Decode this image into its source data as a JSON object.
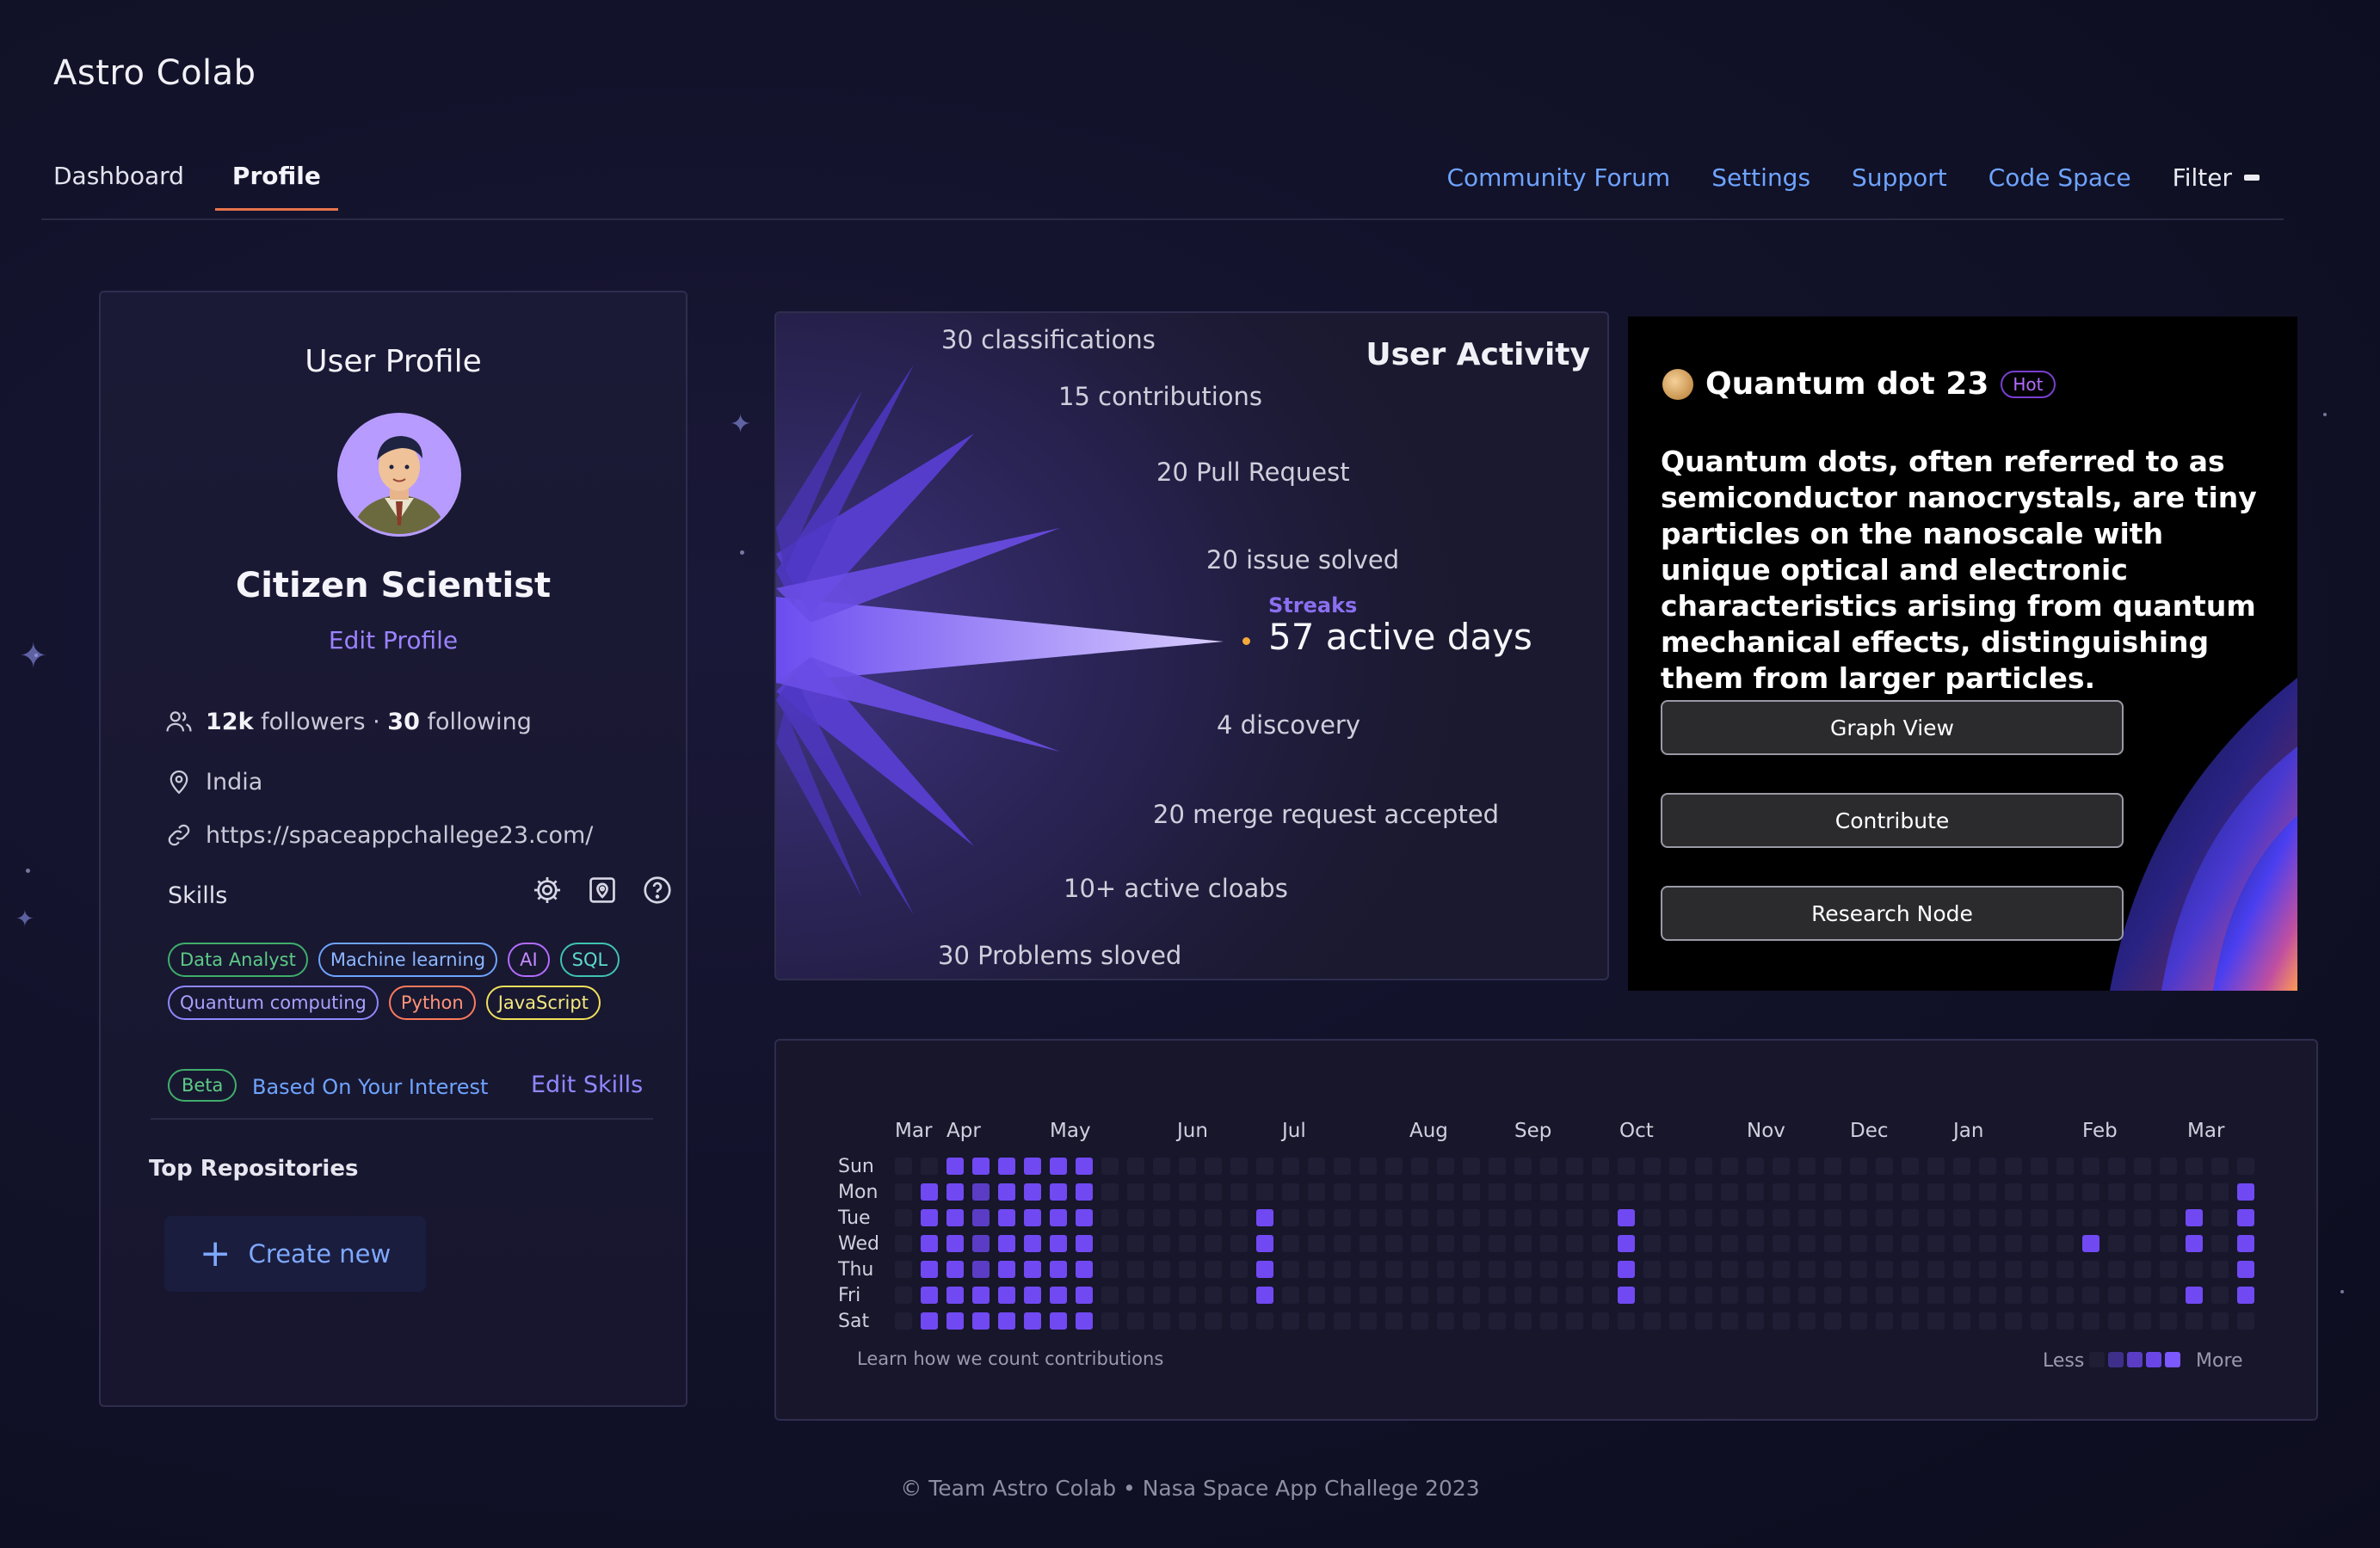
{
  "app": {
    "title": "Astro Colab"
  },
  "tabs": [
    {
      "label": "Dashboard"
    },
    {
      "label": "Profile"
    }
  ],
  "nav": {
    "links": [
      "Community Forum",
      "Settings",
      "Support",
      "Code Space"
    ],
    "filter_label": "Filter"
  },
  "profile": {
    "title": "User Profile",
    "name": "Citizen Scientist",
    "edit_label": "Edit Profile",
    "followers": "12k",
    "followers_label": "followers",
    "following": "30",
    "following_label": "following",
    "location": "India",
    "website": "https://spaceappchallege23.com/",
    "skills_label": "Skills",
    "skills": [
      {
        "label": "Data Analyst",
        "color": "#3fae6a"
      },
      {
        "label": "Machine learning",
        "color": "#6ea4ff"
      },
      {
        "label": "AI",
        "color": "#b36cff"
      },
      {
        "label": "SQL",
        "color": "#3ec3b2"
      },
      {
        "label": "Quantum computing",
        "color": "#8f88ff"
      },
      {
        "label": "Python",
        "color": "#ff7a5c"
      },
      {
        "label": "JavaScript",
        "color": "#f1e05a"
      }
    ],
    "beta_label": "Beta",
    "beta_text": "Based On Your Interest",
    "edit_skills_label": "Edit Skills",
    "top_repos_label": "Top Repositories",
    "create_new_label": "Create new"
  },
  "activity": {
    "title": "User Activity",
    "items": [
      "30 classifications",
      "15 contributions",
      "20 Pull Request",
      "20 issue solved",
      "4 discovery",
      "20 merge request accepted",
      "10+ active cloabs",
      "30 Problems sloved"
    ],
    "streak_title": "Streaks",
    "streak_value": "57 active days"
  },
  "quantum": {
    "title": "Quantum dot 23",
    "badge": "Hot",
    "description": "Quantum dots, often referred to as semiconductor nanocrystals, are tiny particles on the nanoscale with unique optical and electronic characteristics arising from quantum mechanical effects, distinguishing them from larger particles.",
    "buttons": [
      "Graph View",
      "Contribute",
      "Research Node"
    ]
  },
  "contributions": {
    "months": [
      "Mar",
      "Apr",
      "May",
      "Jun",
      "Jul",
      "Aug",
      "Sep",
      "Oct",
      "Nov",
      "Dec",
      "Jan",
      "Feb",
      "Mar"
    ],
    "days": [
      "Sun",
      "Mon",
      "Tue",
      "Wed",
      "Thu",
      "Fri",
      "Sat"
    ],
    "learn_text": "Learn how we count contributions",
    "less_label": "Less",
    "more_label": "More"
  },
  "footer": {
    "text": "© Team Astro Colab • Nasa Space App Challege 2023"
  }
}
